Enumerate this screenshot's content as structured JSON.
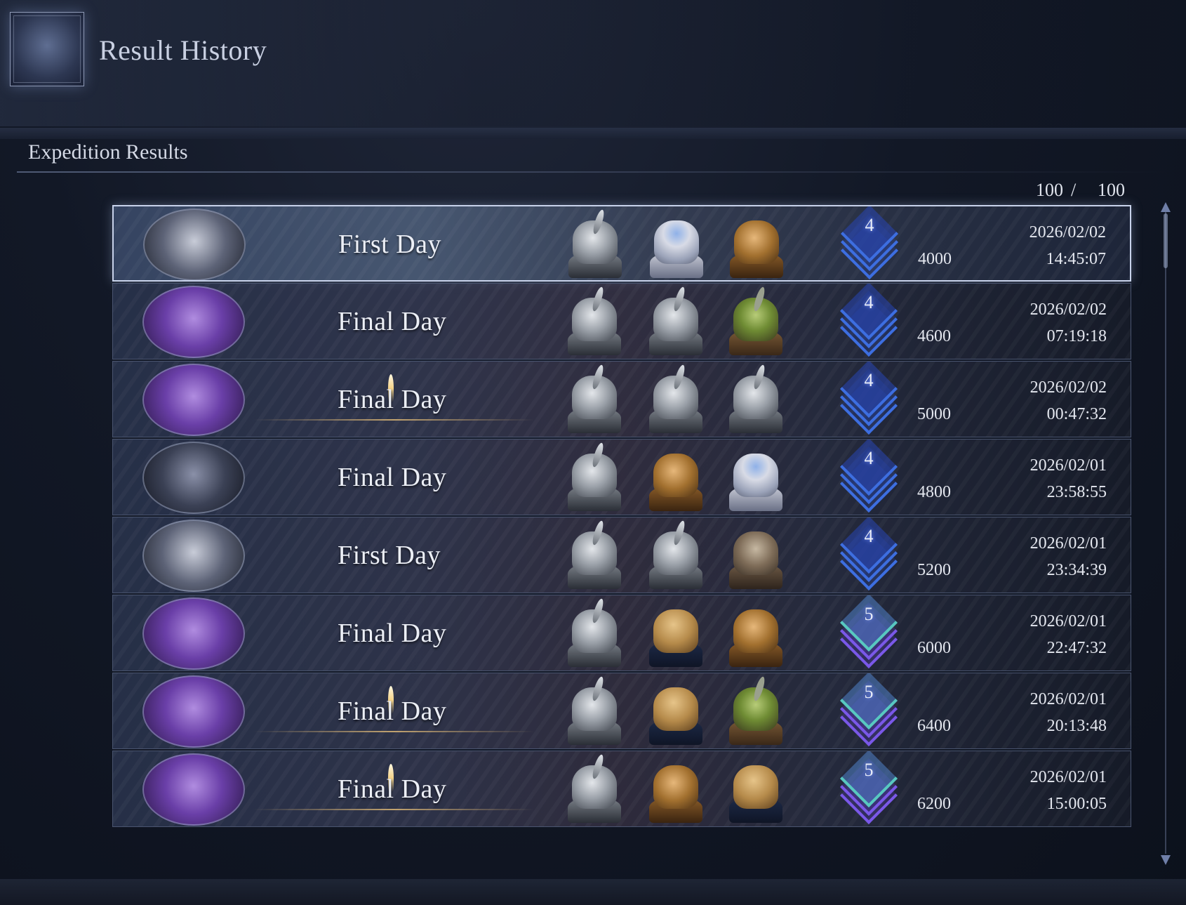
{
  "header": {
    "title": "Result History",
    "emblem_icon": "scroll-icon"
  },
  "section": {
    "title": "Expedition Results"
  },
  "counter": {
    "current": "100",
    "separator": "/",
    "max": "100"
  },
  "results": [
    {
      "boss": "gray",
      "day": "First Day",
      "candle": false,
      "party": [
        "knight",
        "maiden",
        "ranger"
      ],
      "rank": "4",
      "score": "4000",
      "date": "2026/02/02",
      "time": "14:45:07",
      "selected": true
    },
    {
      "boss": "violet",
      "day": "Final Day",
      "candle": false,
      "party": [
        "knight",
        "knight",
        "wilder"
      ],
      "rank": "4",
      "score": "4600",
      "date": "2026/02/02",
      "time": "07:19:18",
      "selected": false
    },
    {
      "boss": "violet",
      "day": "Final Day",
      "candle": true,
      "party": [
        "knight",
        "knight",
        "knight"
      ],
      "rank": "4",
      "score": "5000",
      "date": "2026/02/02",
      "time": "00:47:32",
      "selected": false
    },
    {
      "boss": "dark",
      "day": "Final Day",
      "candle": false,
      "party": [
        "knight",
        "ranger",
        "maiden"
      ],
      "rank": "4",
      "score": "4800",
      "date": "2026/02/01",
      "time": "23:58:55",
      "selected": false
    },
    {
      "boss": "gray",
      "day": "First Day",
      "candle": false,
      "party": [
        "knight",
        "knight",
        "raider"
      ],
      "rank": "4",
      "score": "5200",
      "date": "2026/02/01",
      "time": "23:34:39",
      "selected": false
    },
    {
      "boss": "violet",
      "day": "Final Day",
      "candle": false,
      "party": [
        "knight",
        "goggle",
        "ranger"
      ],
      "rank": "5",
      "score": "6000",
      "date": "2026/02/01",
      "time": "22:47:32",
      "selected": false
    },
    {
      "boss": "violet",
      "day": "Final Day",
      "candle": true,
      "party": [
        "knight",
        "goggle",
        "wilder"
      ],
      "rank": "5",
      "score": "6400",
      "date": "2026/02/01",
      "time": "20:13:48",
      "selected": false
    },
    {
      "boss": "violet",
      "day": "Final Day",
      "candle": true,
      "party": [
        "knight",
        "ranger",
        "goggle"
      ],
      "rank": "5",
      "score": "6200",
      "date": "2026/02/01",
      "time": "15:00:05",
      "selected": false
    }
  ]
}
